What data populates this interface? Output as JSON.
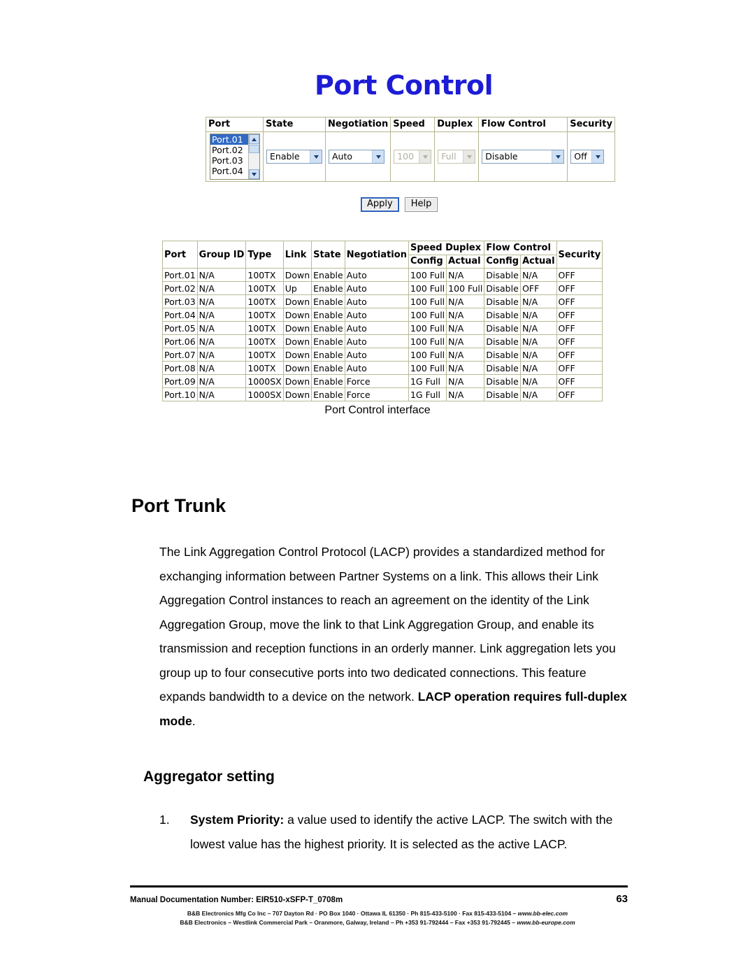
{
  "figure": {
    "title": "Port Control",
    "caption": "Port Control interface",
    "form": {
      "headers": [
        "Port",
        "State",
        "Negotiation",
        "Speed",
        "Duplex",
        "Flow Control",
        "Security"
      ],
      "port_list": {
        "options": [
          "Port.01",
          "Port.02",
          "Port.03",
          "Port.04"
        ],
        "selected": "Port.01"
      },
      "state_select": {
        "value": "Enable",
        "enabled": true
      },
      "negotiation_select": {
        "value": "Auto",
        "enabled": true
      },
      "speed_select": {
        "value": "100",
        "enabled": false
      },
      "duplex_select": {
        "value": "Full",
        "enabled": false
      },
      "flow_control_select": {
        "value": "Disable",
        "enabled": true
      },
      "security_select": {
        "value": "Off",
        "enabled": true
      },
      "apply_label": "Apply",
      "help_label": "Help"
    },
    "status_table": {
      "headers_top": [
        "Port",
        "Group ID",
        "Type",
        "Link",
        "State",
        "Negotiation",
        "Speed Duplex",
        "Flow Control",
        "Security"
      ],
      "headers_sub": [
        "Config",
        "Actual",
        "Config",
        "Actual"
      ],
      "rows": [
        [
          "Port.01",
          "N/A",
          "100TX",
          "Down",
          "Enable",
          "Auto",
          "100 Full",
          "N/A",
          "Disable",
          "N/A",
          "OFF"
        ],
        [
          "Port.02",
          "N/A",
          "100TX",
          "Up",
          "Enable",
          "Auto",
          "100 Full",
          "100 Full",
          "Disable",
          "OFF",
          "OFF"
        ],
        [
          "Port.03",
          "N/A",
          "100TX",
          "Down",
          "Enable",
          "Auto",
          "100 Full",
          "N/A",
          "Disable",
          "N/A",
          "OFF"
        ],
        [
          "Port.04",
          "N/A",
          "100TX",
          "Down",
          "Enable",
          "Auto",
          "100 Full",
          "N/A",
          "Disable",
          "N/A",
          "OFF"
        ],
        [
          "Port.05",
          "N/A",
          "100TX",
          "Down",
          "Enable",
          "Auto",
          "100 Full",
          "N/A",
          "Disable",
          "N/A",
          "OFF"
        ],
        [
          "Port.06",
          "N/A",
          "100TX",
          "Down",
          "Enable",
          "Auto",
          "100 Full",
          "N/A",
          "Disable",
          "N/A",
          "OFF"
        ],
        [
          "Port.07",
          "N/A",
          "100TX",
          "Down",
          "Enable",
          "Auto",
          "100 Full",
          "N/A",
          "Disable",
          "N/A",
          "OFF"
        ],
        [
          "Port.08",
          "N/A",
          "100TX",
          "Down",
          "Enable",
          "Auto",
          "100 Full",
          "N/A",
          "Disable",
          "N/A",
          "OFF"
        ],
        [
          "Port.09",
          "N/A",
          "1000SX",
          "Down",
          "Enable",
          "Force",
          "1G Full",
          "N/A",
          "Disable",
          "N/A",
          "OFF"
        ],
        [
          "Port.10",
          "N/A",
          "1000SX",
          "Down",
          "Enable",
          "Force",
          "1G Full",
          "N/A",
          "Disable",
          "N/A",
          "OFF"
        ]
      ]
    }
  },
  "content": {
    "heading": "Port Trunk",
    "paragraph_plain": "The Link Aggregation Control Protocol (LACP) provides a standardized method for exchanging information between Partner Systems on a link. This allows their Link Aggregation Control instances to reach an agreement on the identity of the Link Aggregation Group, move the link to that Link Aggregation Group, and enable its transmission and reception functions in an orderly manner. Link aggregation lets you group up to four consecutive ports into two dedicated connections. This feature expands bandwidth to a device on the network. ",
    "paragraph_bold": "LACP operation requires full-duplex mode",
    "paragraph_tail": ".",
    "subheading": "Aggregator setting",
    "list_items": [
      {
        "number": "1.",
        "bold_lead": "System Priority:",
        "text": " a value used to identify the active LACP. The switch with the lowest value has the highest priority. It is selected as the active LACP."
      }
    ]
  },
  "footer": {
    "doc_number": "Manual Documentation Number: EIR510-xSFP-T_0708m",
    "page_number": "63",
    "address_line1_a": "B&B Electronics Mfg Co Inc – 707 Dayton Rd · PO Box 1040 · Ottawa IL 61350 · Ph 815-433-5100 · Fax 815-433-5104 – ",
    "address_line1_url": "www.bb-elec.com",
    "address_line2_a": "B&B Electronics – Westlink Commercial Park – Oranmore, Galway, Ireland – Ph +353 91-792444 – Fax +353 91-792445 – ",
    "address_line2_url": "www.bb-europe.com"
  },
  "colors": {
    "title_blue": "#1c1cd6",
    "selection_blue": "#316ac5"
  }
}
